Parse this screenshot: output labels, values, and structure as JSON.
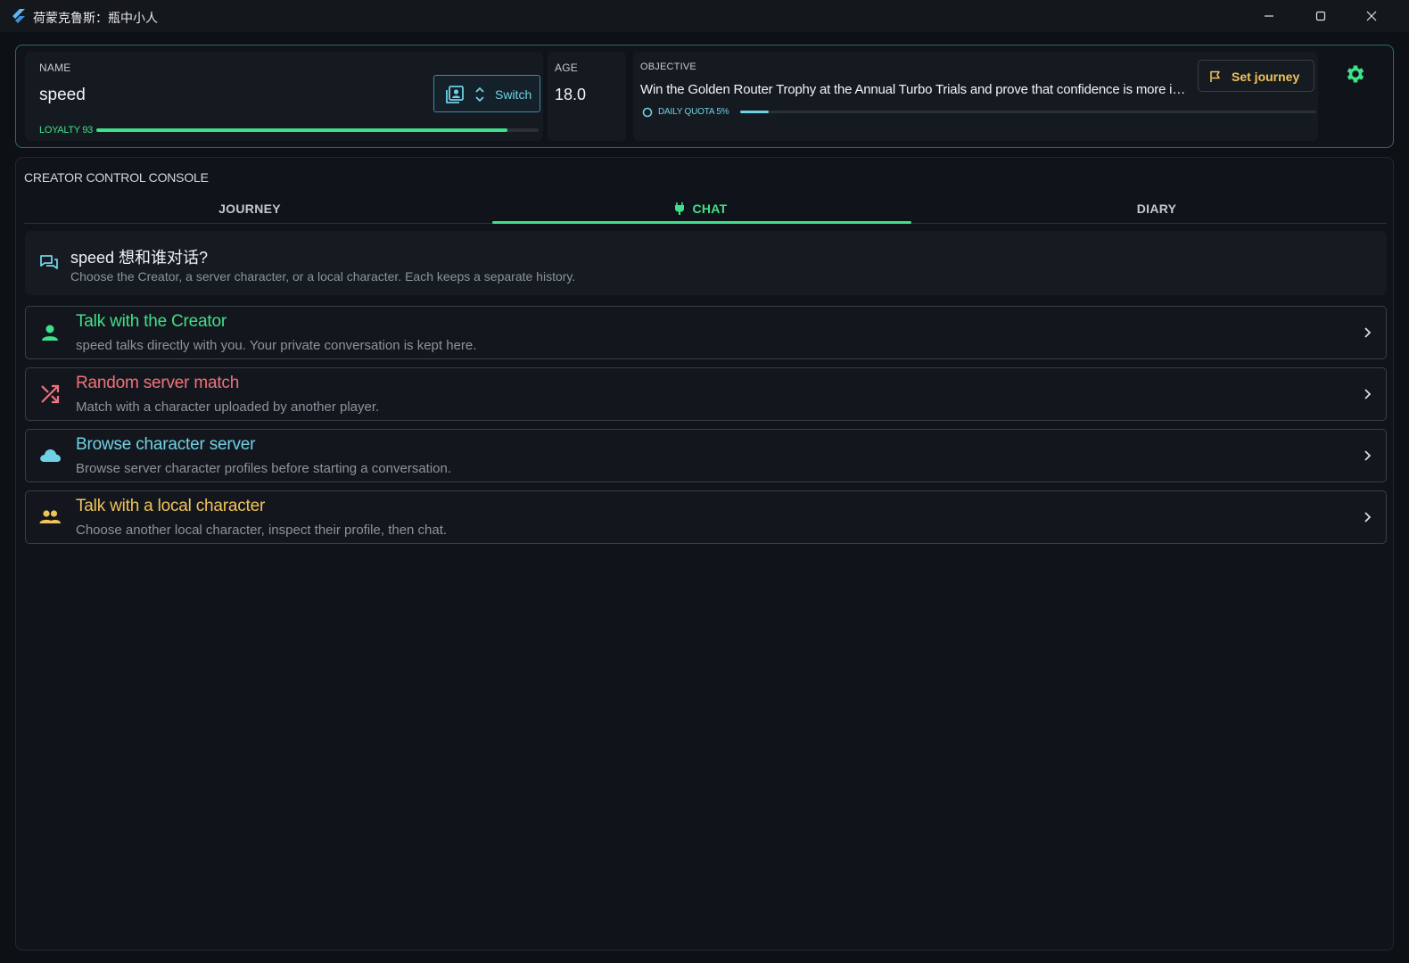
{
  "window": {
    "title": "荷蒙克鲁斯：瓶中小人",
    "controls": [
      "minimize-icon",
      "maximize-icon",
      "close-icon"
    ]
  },
  "header": {
    "name_label": "NAME",
    "name_value": "speed",
    "switch_label": "Switch",
    "loyalty_label": "LOYALTY 93",
    "loyalty_value": 93,
    "age_label": "AGE",
    "age_value": "18.0",
    "objective_label": "OBJECTIVE",
    "objective_text": "Win the Golden Router Trophy at the Annual Turbo Trials and prove that confidence is more important than skill",
    "quota_label": "DAILY QUOTA 5%",
    "quota_value": 5,
    "set_journey_label": "Set journey"
  },
  "console": {
    "title": "CREATOR CONTROL CONSOLE",
    "tabs": [
      {
        "label": "JOURNEY",
        "active": false
      },
      {
        "label": "CHAT",
        "active": true
      },
      {
        "label": "DIARY",
        "active": false
      }
    ],
    "intro": {
      "title": "speed 想和谁对话?",
      "subtitle": "Choose the Creator, a server character, or a local character. Each keeps a separate history."
    },
    "options": [
      {
        "title": "Talk with the Creator",
        "desc": "speed talks directly with you. Your private conversation is kept here.",
        "color": "#3fe08a",
        "icon": "person-icon"
      },
      {
        "title": "Random server match",
        "desc": "Match with a character uploaded by another player.",
        "color": "#f0727c",
        "icon": "shuffle-icon"
      },
      {
        "title": "Browse character server",
        "desc": "Browse server character profiles before starting a conversation.",
        "color": "#6fd1e6",
        "icon": "cloud-icon"
      },
      {
        "title": "Talk with a local character",
        "desc": "Choose another local character, inspect their profile, then chat.",
        "color": "#f0c25a",
        "icon": "people-icon"
      }
    ]
  },
  "colors": {
    "accent_green": "#3fe08a",
    "accent_cyan": "#6fd1e6",
    "accent_yellow": "#f0c25a",
    "accent_red": "#f0727c"
  }
}
